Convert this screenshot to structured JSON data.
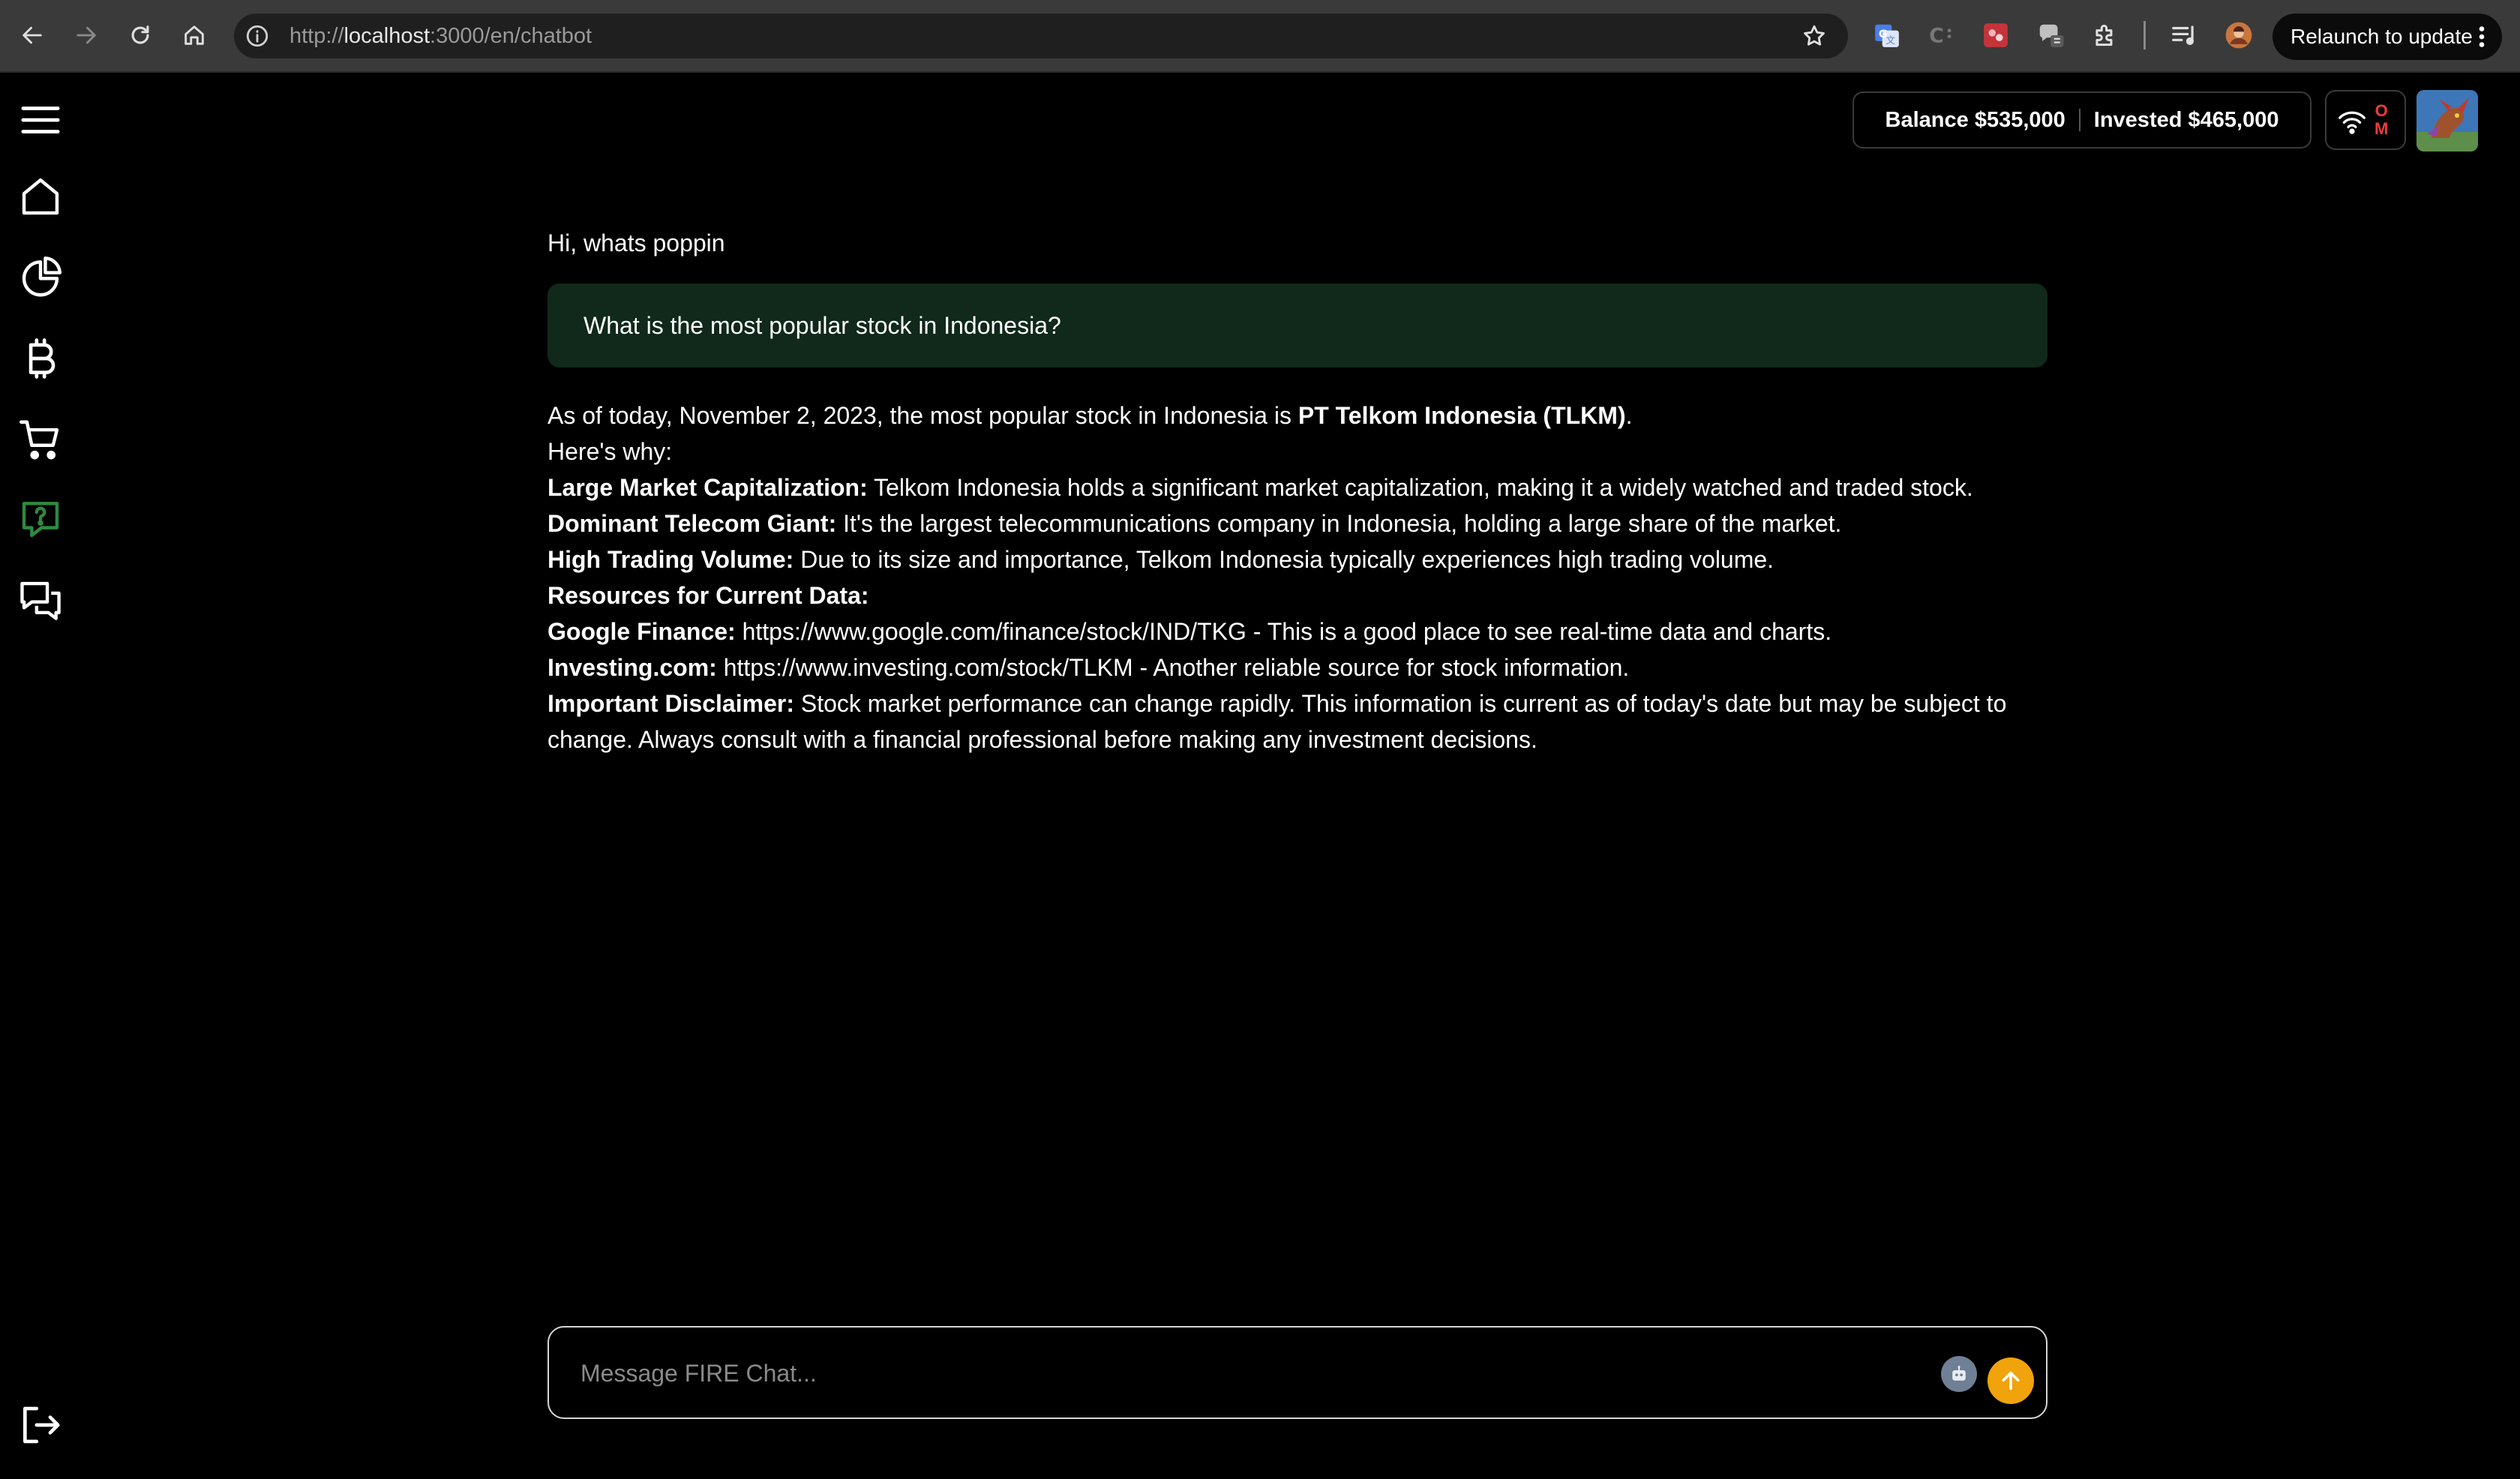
{
  "browser": {
    "url_prefix": "http://",
    "url_host": "localhost",
    "url_rest": ":3000/en/chatbot",
    "relaunch_label": "Relaunch to update"
  },
  "sidebar": {
    "items": [
      {
        "icon": "menu-icon"
      },
      {
        "icon": "home-icon"
      },
      {
        "icon": "pie-chart-icon"
      },
      {
        "icon": "bitcoin-icon"
      },
      {
        "icon": "cart-icon"
      },
      {
        "icon": "help-chat-icon",
        "active": true
      },
      {
        "icon": "chat-bubbles-icon"
      },
      {
        "icon": "logout-icon"
      }
    ],
    "active_color": "#2e8b3e"
  },
  "header": {
    "balance": "Balance $535,000",
    "invested": "Invested $465,000",
    "status_letters": [
      "O",
      "M"
    ],
    "status_color": "#ef3b3b"
  },
  "chat": {
    "greeting": "Hi, whats poppin",
    "user_message": "What is the most popular stock in Indonesia?",
    "answer": {
      "intro_prefix": "As of today, November 2, 2023, the most popular stock in Indonesia is ",
      "intro_bold": "PT Telkom Indonesia (TLKM)",
      "intro_suffix": ".",
      "heres_why": "Here's why:",
      "points": [
        {
          "label": "Large Market Capitalization:",
          "text": " Telkom Indonesia holds a significant market capitalization, making it a widely watched and traded stock."
        },
        {
          "label": "Dominant Telecom Giant:",
          "text": " It's the largest telecommunications company in Indonesia, holding a large share of the market."
        },
        {
          "label": "High Trading Volume:",
          "text": " Due to its size and importance, Telkom Indonesia typically experiences high trading volume."
        }
      ],
      "resources_heading": "Resources for Current Data:",
      "resources": [
        {
          "label": "Google Finance:",
          "text": " https://www.google.com/finance/stock/IND/TKG - This is a good place to see real-time data and charts."
        },
        {
          "label": "Investing.com:",
          "text": " https://www.investing.com/stock/TLKM - Another reliable source for stock information."
        }
      ],
      "disclaimer_label": "Important Disclaimer:",
      "disclaimer_text": " Stock market performance can change rapidly. This information is current as of today's date but may be subject to change. Always consult with a financial professional before making any investment decisions."
    }
  },
  "composer": {
    "placeholder": "Message FIRE Chat...",
    "send_color": "#f0a30a"
  }
}
